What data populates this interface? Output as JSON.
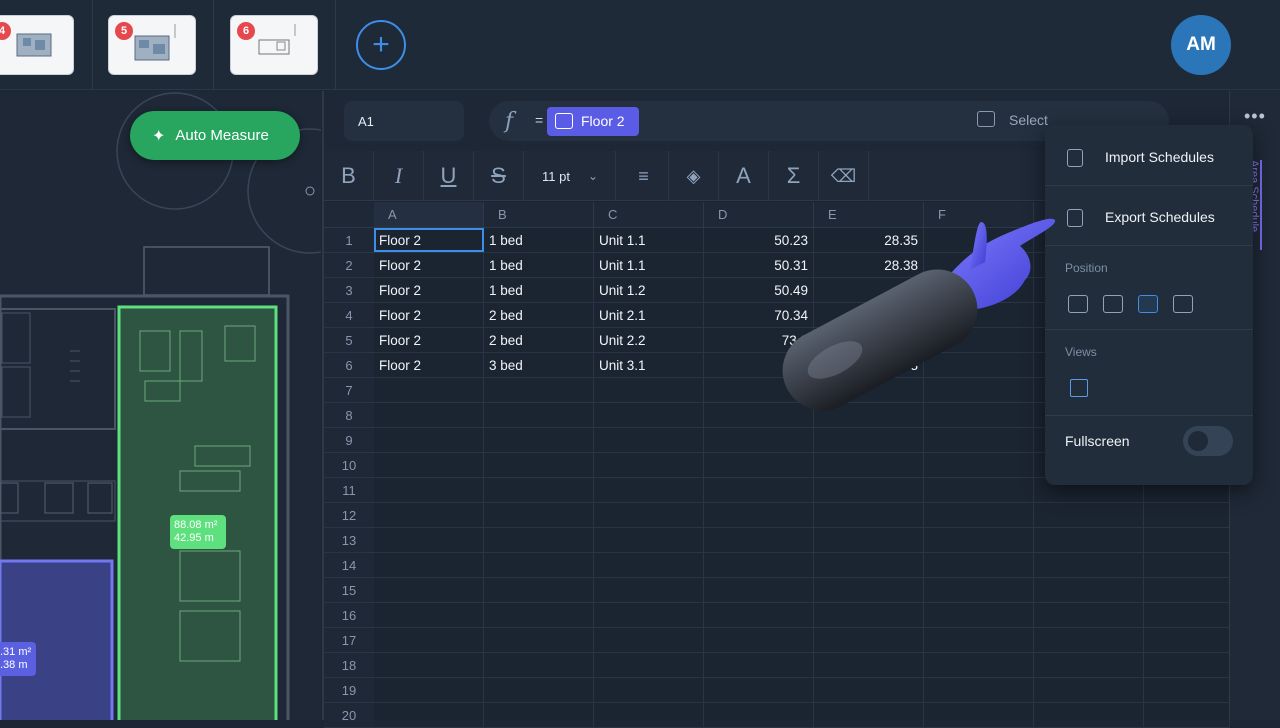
{
  "thumbnails": [
    {
      "badge": "4"
    },
    {
      "badge": "5"
    },
    {
      "badge": "6"
    }
  ],
  "user": {
    "initials": "AM"
  },
  "auto_measure": {
    "label": "Auto Measure"
  },
  "plan_labels": {
    "green_area": "88.08 m²",
    "green_perimeter": "42.95 m",
    "blue_area": ".31 m²",
    "blue_perimeter": ".38 m"
  },
  "formula_bar": {
    "cell_ref": "A1",
    "fx": "f",
    "equals": "=",
    "chip_label": "Floor 2",
    "select_label": "Select"
  },
  "toolbar": {
    "bold": "B",
    "italic": "I",
    "underline": "U",
    "strike": "S",
    "font_size": "11 pt",
    "font_color": "A",
    "sum": "Σ"
  },
  "columns": [
    "A",
    "B",
    "C",
    "D",
    "E",
    "F"
  ],
  "rows": [
    {
      "n": "1",
      "a": "Floor 2",
      "b": "1 bed",
      "c": "Unit 1.1",
      "d": "50.23",
      "e": "28.35"
    },
    {
      "n": "2",
      "a": "Floor 2",
      "b": "1 bed",
      "c": "Unit 1.1",
      "d": "50.31",
      "e": "28.38"
    },
    {
      "n": "3",
      "a": "Floor 2",
      "b": "1 bed",
      "c": "Unit 1.2",
      "d": "50.49",
      "e": "2"
    },
    {
      "n": "4",
      "a": "Floor 2",
      "b": "2 bed",
      "c": "Unit 2.1",
      "d": "70.34",
      "e": ""
    },
    {
      "n": "5",
      "a": "Floor 2",
      "b": "2 bed",
      "c": "Unit 2.2",
      "d": "73.2",
      "e": ""
    },
    {
      "n": "6",
      "a": "Floor 2",
      "b": "3 bed",
      "c": "Unit 3.1",
      "d": "",
      "e": "3"
    },
    {
      "n": "7"
    },
    {
      "n": "8"
    },
    {
      "n": "9"
    },
    {
      "n": "10"
    },
    {
      "n": "11"
    },
    {
      "n": "12"
    },
    {
      "n": "13"
    },
    {
      "n": "14"
    },
    {
      "n": "15"
    },
    {
      "n": "16"
    },
    {
      "n": "17"
    },
    {
      "n": "18"
    },
    {
      "n": "19"
    },
    {
      "n": "20"
    }
  ],
  "menu": {
    "import": "Import Schedules",
    "export": "Export Schedules",
    "position": "Position",
    "views": "Views",
    "fullscreen": "Fullscreen"
  },
  "side_tab": "Area Schedule"
}
